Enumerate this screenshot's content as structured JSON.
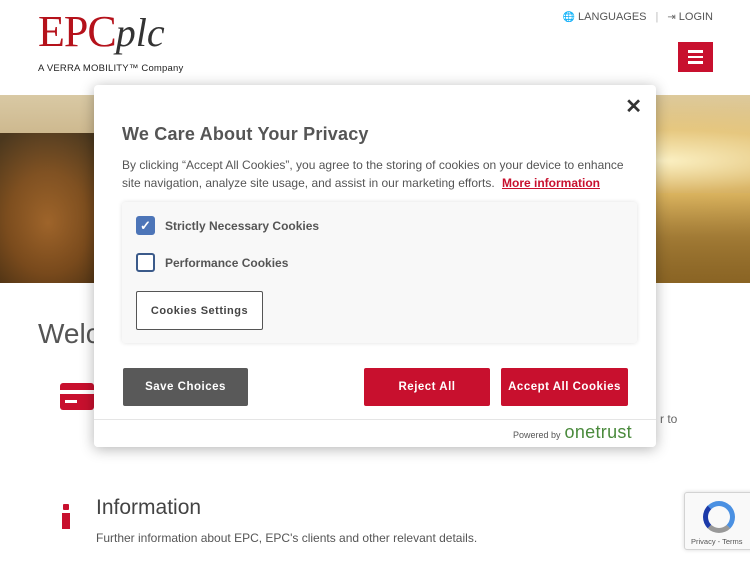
{
  "header": {
    "logo_main": "EPC",
    "logo_suffix": "plc",
    "logo_tagline": "A VERRA MOBILITY™ Company",
    "languages_label": "LANGUAGES",
    "login_label": "LOGIN"
  },
  "page": {
    "welcome_partial": "Welc",
    "partial_text": "r to",
    "info_title": "Information",
    "info_desc": "Further information about EPC, EPC's clients and other relevant details."
  },
  "privacy_modal": {
    "title": "We Care About Your Privacy",
    "description": "By clicking “Accept All Cookies”, you agree to the storing of cookies on your device to enhance site navigation, analyze site usage, and assist in our marketing efforts.",
    "more_info_label": "More information",
    "cookies": [
      {
        "label": "Strictly Necessary Cookies",
        "checked": true
      },
      {
        "label": "Performance Cookies",
        "checked": false
      }
    ],
    "settings_label": "Cookies Settings",
    "save_label": "Save Choices",
    "reject_label": "Reject All",
    "accept_label": "Accept All Cookies",
    "powered_by": "Powered by",
    "brand": "onetrust"
  },
  "recaptcha": {
    "terms": "Privacy - Terms"
  },
  "colors": {
    "brand_red": "#c8102e",
    "checkbox_blue": "#4d75b8",
    "save_gray": "#595959",
    "onetrust_green": "#4a8a3c"
  }
}
